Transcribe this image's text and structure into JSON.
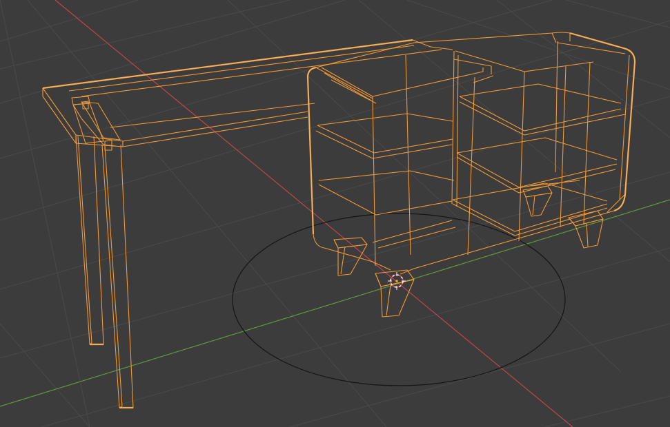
{
  "viewport": {
    "background_color": "#3c3c3c",
    "grid_color": "#4a4a4a",
    "x_axis_color": "#c0454f",
    "y_axis_color": "#5e9a3a",
    "selection_color": "#f29a38",
    "selection_outline_color": "#ffb35a",
    "ground_circle_color": "#141414",
    "cursor_primary_color": "#ffffff",
    "cursor_secondary_color": "#e0444a"
  },
  "scene": {
    "object": "desk-with-shelf-cabinet",
    "mode": "wireframe-selected",
    "gizmos": [
      "3d-cursor",
      "ground-circle",
      "floor-grid",
      "x-axis-line",
      "y-axis-line"
    ]
  }
}
